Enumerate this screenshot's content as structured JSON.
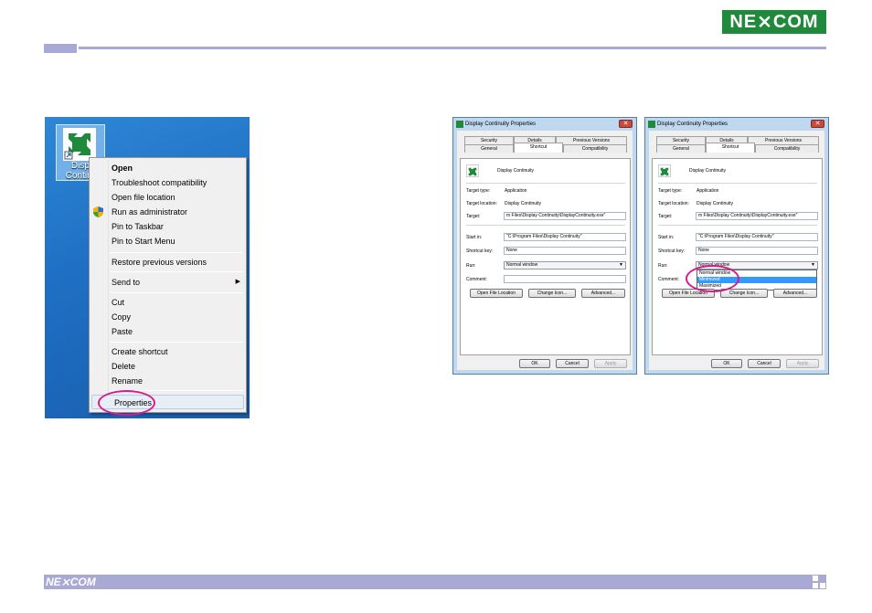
{
  "brand": {
    "logo_text": "NE⨯COM",
    "footer_logo_text": "NE⨯COM",
    "color": "#1f8a3b",
    "band_color": "#a9a9d6"
  },
  "desktop": {
    "icon_label_line1": "Displ",
    "icon_label_line2": "Continu"
  },
  "context_menu": {
    "items": [
      {
        "label": "Open"
      },
      {
        "label": "Troubleshoot compatibility"
      },
      {
        "label": "Open file location"
      },
      {
        "label": "Run as administrator",
        "icon": "shield-icon"
      },
      {
        "label": "Pin to Taskbar"
      },
      {
        "label": "Pin to Start Menu"
      },
      {
        "label": "Restore previous versions"
      },
      {
        "label": "Send to"
      },
      {
        "label": "Cut"
      },
      {
        "label": "Copy"
      },
      {
        "label": "Paste"
      },
      {
        "label": "Create shortcut"
      },
      {
        "label": "Delete"
      },
      {
        "label": "Rename"
      },
      {
        "label": "Properties"
      }
    ]
  },
  "dialog": {
    "title": "Display Continuity Properties",
    "tabs_row1": [
      "Security",
      "Details",
      "Previous Versions"
    ],
    "tabs_row2": [
      "General",
      "Shortcut",
      "Compatibility"
    ],
    "app_name": "Display Continuity",
    "target_type_label": "Target type:",
    "target_type_value": "Application",
    "target_location_label": "Target location:",
    "target_location_value": "Display Continuity",
    "target_label": "Target:",
    "target_value": "m Files\\Display Continuity\\DisplayContinuity.exe\"",
    "start_in_label": "Start in:",
    "start_in_value": "\"C:\\Program Files\\Display Continuity\"",
    "shortcut_key_label": "Shortcut key:",
    "shortcut_key_value": "None",
    "run_label": "Run:",
    "run_value": "Normal window",
    "comment_label": "Comment:",
    "open_file_location": "Open File Location",
    "change_icon": "Change Icon...",
    "advanced": "Advanced...",
    "ok": "OK",
    "cancel": "Cancel",
    "apply": "Apply",
    "run_options": [
      "Normal window",
      "Minimized",
      "Maximized"
    ]
  }
}
